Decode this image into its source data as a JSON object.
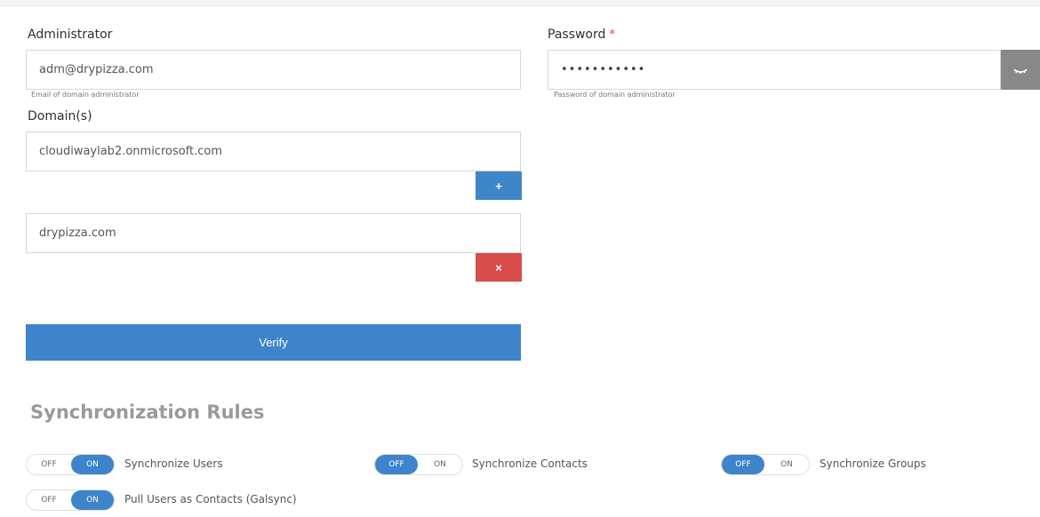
{
  "admin": {
    "label": "Administrator",
    "value": "adm@drypizza.com",
    "hint": "Email of domain administrator"
  },
  "password": {
    "label": "Password",
    "required_mark": "*",
    "value": "•••••••••••",
    "hint": "Password of domain administrator",
    "toggle_icon": "eye-icon"
  },
  "domains": {
    "label": "Domain(s)",
    "items": [
      {
        "value": "cloudiwaylab2.onmicrosoft.com",
        "action_symbol": "+"
      },
      {
        "value": "drypizza.com",
        "action_symbol": "×"
      }
    ]
  },
  "verify": {
    "label": "Verify"
  },
  "sync": {
    "title": "Synchronization Rules",
    "rules": [
      {
        "label": "Synchronize Users",
        "off": "OFF",
        "on": "ON",
        "selected": "ON"
      },
      {
        "label": "Synchronize Contacts",
        "off": "OFF",
        "on": "ON",
        "selected": "OFF"
      },
      {
        "label": "Synchronize Groups",
        "off": "OFF",
        "on": "ON",
        "selected": "OFF"
      },
      {
        "label": "Pull Users as Contacts (Galsync)",
        "off": "OFF",
        "on": "ON",
        "selected": "ON"
      }
    ]
  },
  "colors": {
    "accent": "#3d84cb",
    "danger": "#d94c4c",
    "required": "#d9534f"
  }
}
